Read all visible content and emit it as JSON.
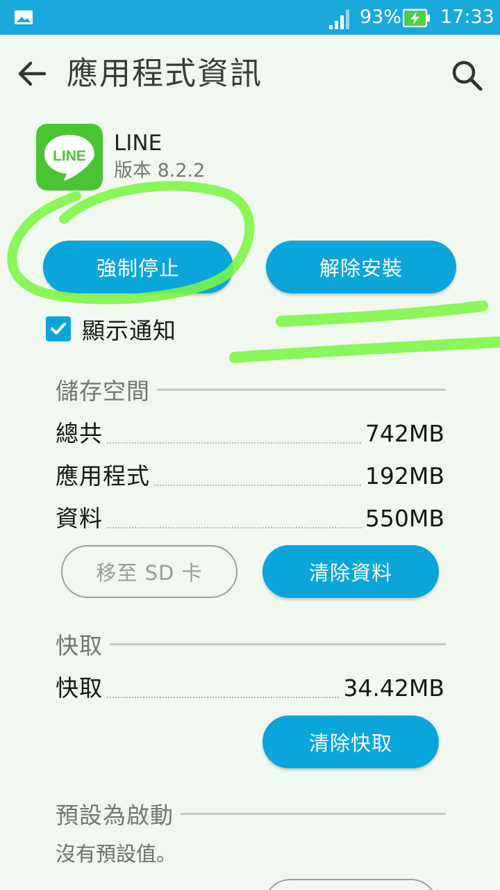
{
  "status_bar": {
    "battery_percent": "93%",
    "time": "17:33",
    "icons": [
      "gallery-icon",
      "signal-icon",
      "battery-charging-icon"
    ]
  },
  "app_bar": {
    "title": "應用程式資訊",
    "icons": [
      "back-arrow-icon",
      "search-icon"
    ]
  },
  "app": {
    "name": "LINE",
    "version": "版本 8.2.2",
    "icon_text": "LINE",
    "icon_color": "#4bc434"
  },
  "actions": {
    "force_stop": "強制停止",
    "uninstall": "解除安裝"
  },
  "notifications": {
    "label": "顯示通知",
    "checked": true
  },
  "storage": {
    "title": "儲存空間",
    "rows": [
      {
        "label": "總共",
        "value": "742MB"
      },
      {
        "label": "應用程式",
        "value": "192MB"
      },
      {
        "label": "資料",
        "value": "550MB"
      }
    ],
    "move_sd": "移至 SD 卡",
    "clear_data": "清除資料"
  },
  "cache": {
    "title": "快取",
    "rows": [
      {
        "label": "快取",
        "value": "34.42MB"
      }
    ],
    "clear_cache": "清除快取"
  },
  "launch_default": {
    "title": "預設為啟動",
    "text": "沒有預設值。"
  },
  "colors": {
    "accent": "#0aa6db",
    "status_bar": "#19a9dd",
    "background": "#f1f8ef",
    "annotation": "#7cf545"
  }
}
